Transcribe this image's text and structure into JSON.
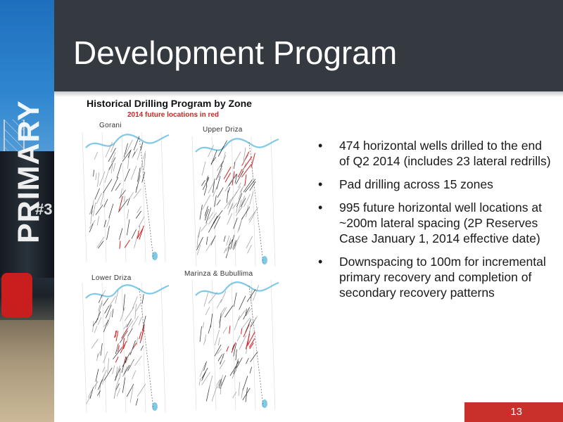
{
  "slide": {
    "title": "Development Program",
    "side_word": "PRIMARY",
    "side_number": "#3",
    "page_number": "13"
  },
  "figure": {
    "title": "Historical Drilling Program by Zone",
    "subtitle": "2014 future locations in red",
    "panels": [
      {
        "id": "gorani",
        "label": "Gorani"
      },
      {
        "id": "upper-driza",
        "label": "Upper Driza"
      },
      {
        "id": "lower-driza",
        "label": "Lower Driza"
      },
      {
        "id": "marinza-bubullima",
        "label": "Marinza & Bubullima"
      }
    ]
  },
  "bullets": [
    "474 horizontal wells drilled to the end of Q2 2014 (includes 23 lateral redrills)",
    "Pad drilling across 15 zones",
    "995 future horizontal well locations at ~200m lateral spacing (2P Reserves Case January 1, 2014 effective date)",
    "Downspacing to 100m for incremental primary recovery and completion of secondary recovery patterns"
  ],
  "colors": {
    "header_bg": "#343a40",
    "future_location_red": "#d81f26",
    "drilled_wells": "#2a2a2a",
    "river_blue": "#7fc8e6",
    "page_box_red": "#c9302c"
  }
}
